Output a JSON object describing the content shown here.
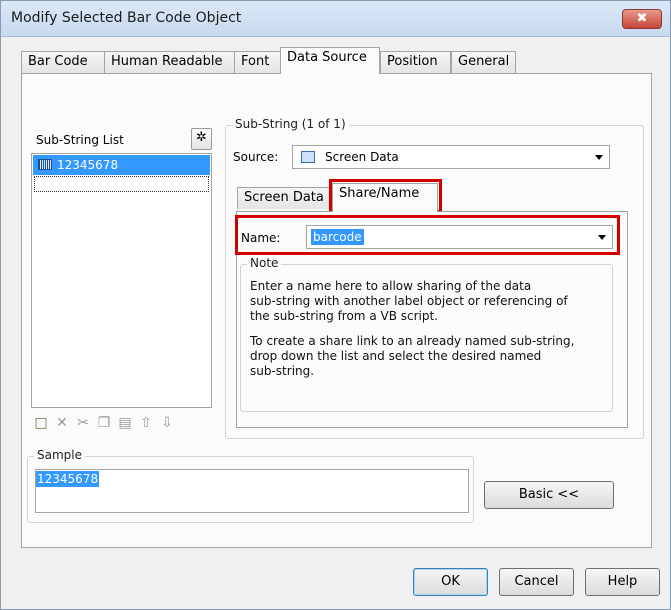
{
  "window": {
    "title": "Modify Selected Bar Code Object",
    "close_label": "✖"
  },
  "tabs": [
    {
      "label": "Bar Code"
    },
    {
      "label": "Human Readable"
    },
    {
      "label": "Font"
    },
    {
      "label": "Data Source"
    },
    {
      "label": "Position"
    },
    {
      "label": "General"
    }
  ],
  "active_tab": "Data Source",
  "substring_list": {
    "label": "Sub-String List",
    "items": [
      "12345678"
    ],
    "wizard_icon": "magic-wand-icon",
    "toolbar_icons": [
      "new-icon",
      "delete-icon",
      "cut-icon",
      "copy-icon",
      "paste-icon",
      "move-up-icon",
      "move-down-icon"
    ]
  },
  "substring": {
    "label": "Sub-String (1 of 1)",
    "source_label": "Source:",
    "source_value": "Screen Data",
    "inner_tabs": [
      {
        "label": "Screen Data"
      },
      {
        "label": "Share/Name"
      }
    ],
    "active_inner_tab": "Share/Name",
    "name_label": "Name:",
    "name_value": "barcode"
  },
  "note": {
    "label": "Note",
    "para1": [
      "Enter a name here to allow sharing of the data",
      "sub-string with another label object or referencing of",
      "the sub-string from a VB script."
    ],
    "para2": [
      "To create a share link to an already named sub-string,",
      "drop down the list and select the desired named",
      "sub-string."
    ]
  },
  "sample": {
    "label": "Sample",
    "value": "12345678"
  },
  "buttons": {
    "basic": "Basic <<",
    "ok": "OK",
    "cancel": "Cancel",
    "help": "Help"
  },
  "colors": {
    "highlight": "#3399ff",
    "annotation_red": "#d40000"
  }
}
